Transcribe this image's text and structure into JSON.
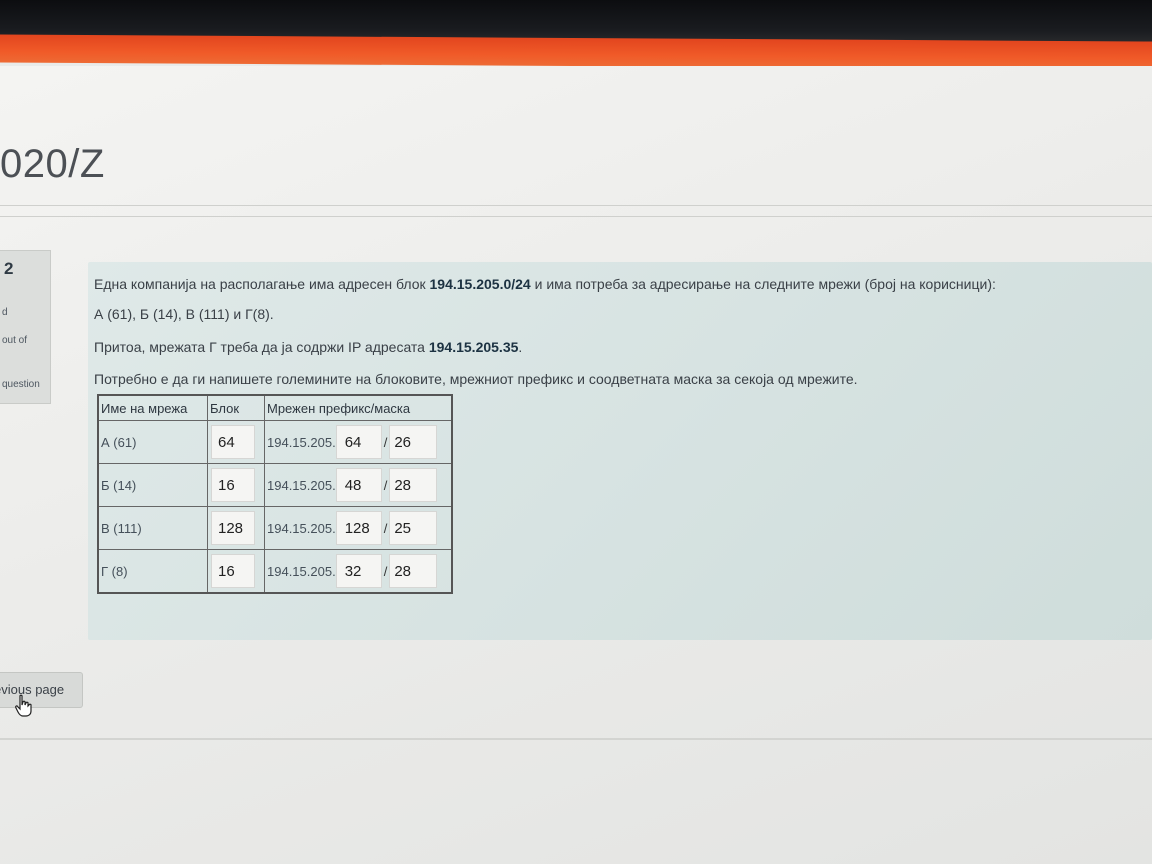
{
  "header": {
    "course_title": "020/Z"
  },
  "question_info": {
    "number": "2",
    "line1": "d",
    "line2": "out of",
    "line3": "question"
  },
  "question": {
    "p1_before": "Една компанија на располагање има адресен блок ",
    "p1_bold": "194.15.205.0/24",
    "p1_after": " и има потреба за адресирање на следните мрежи (број на корисници):",
    "p2": "А (61), Б (14), В (111) и Г(8).",
    "p3_before": "Притоа, мрежата Г треба да ја содржи IP адресата ",
    "p3_bold": "194.15.205.35",
    "p3_after": ".",
    "p4": "Потребно е да ги напишете големините на блоковите, мрежниот префикс и соодветната маска за секоја од мрежите."
  },
  "table": {
    "headers": [
      "Име на мрежа",
      "Блок",
      "Мрежен префикс/маска"
    ],
    "prefix_text": "194.15.205.",
    "slash": "/",
    "rows": [
      {
        "name": "А (61)",
        "block": "64",
        "prefix": "64",
        "mask": "26"
      },
      {
        "name": "Б (14)",
        "block": "16",
        "prefix": "48",
        "mask": "28"
      },
      {
        "name": "В (111)",
        "block": "128",
        "prefix": "128",
        "mask": "25"
      },
      {
        "name": "Г (8)",
        "block": "16",
        "prefix": "32",
        "mask": "28"
      }
    ]
  },
  "nav": {
    "previous_page_label": "evious page"
  },
  "colors": {
    "accent": "#f05a28",
    "question_bg": "#d7e3e2"
  }
}
